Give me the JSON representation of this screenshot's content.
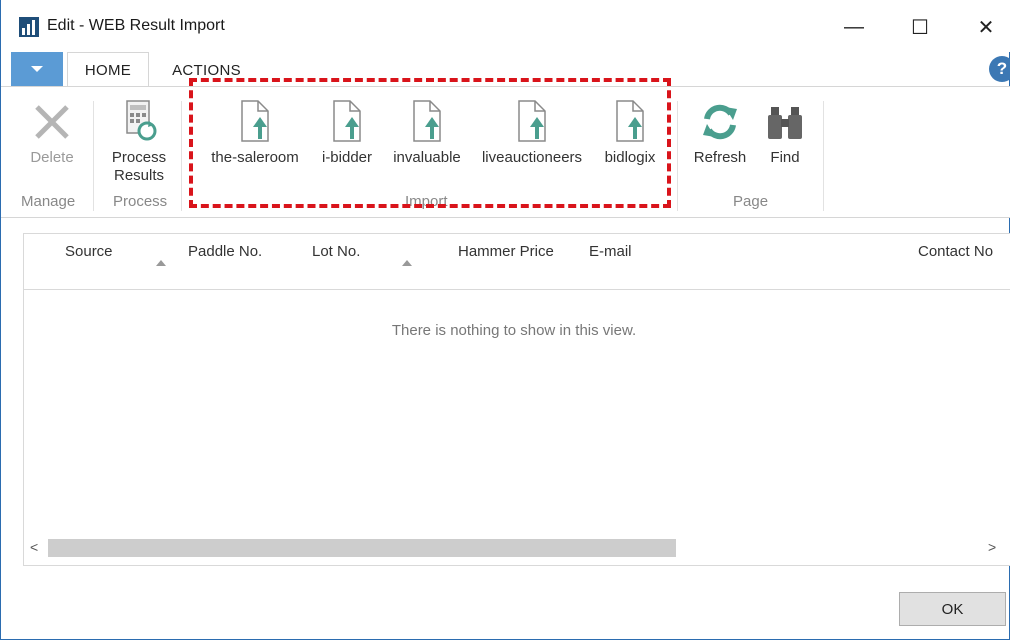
{
  "window": {
    "title": "Edit - WEB Result Import",
    "minimize_glyph": "—",
    "maximize_glyph": "☐",
    "close_glyph": "✕"
  },
  "tabs": [
    {
      "label": "HOME",
      "active": true
    },
    {
      "label": "ACTIONS",
      "active": false
    }
  ],
  "help_glyph": "?",
  "ribbon": {
    "manage": {
      "label": "Manage",
      "buttons": [
        {
          "label": "Delete",
          "icon": "delete-x-icon",
          "enabled": false
        }
      ]
    },
    "process": {
      "label": "Process",
      "buttons": [
        {
          "label": "Process Results",
          "icon": "process-results-icon"
        }
      ]
    },
    "import": {
      "label": "Import",
      "buttons": [
        {
          "label": "the-saleroom",
          "icon": "document-import-icon"
        },
        {
          "label": "i-bidder",
          "icon": "document-import-icon"
        },
        {
          "label": "invaluable",
          "icon": "document-import-icon"
        },
        {
          "label": "liveauctioneers",
          "icon": "document-import-icon"
        },
        {
          "label": "bidlogix",
          "icon": "document-import-icon"
        }
      ]
    },
    "page": {
      "label": "Page",
      "buttons": [
        {
          "label": "Refresh",
          "icon": "refresh-icon"
        },
        {
          "label": "Find",
          "icon": "binoculars-icon"
        }
      ]
    }
  },
  "grid": {
    "columns": [
      "Source",
      "Paddle No.",
      "Lot No.",
      "Hammer Price",
      "E-mail",
      "Contact No"
    ],
    "empty_message": "There is nothing to show in this view.",
    "scroll_left": "<",
    "scroll_right": ">"
  },
  "footer": {
    "ok_label": "OK"
  },
  "colors": {
    "accent": "#5b9bd5",
    "import_arrow": "#4a9e8e",
    "highlight": "#d9141b"
  }
}
